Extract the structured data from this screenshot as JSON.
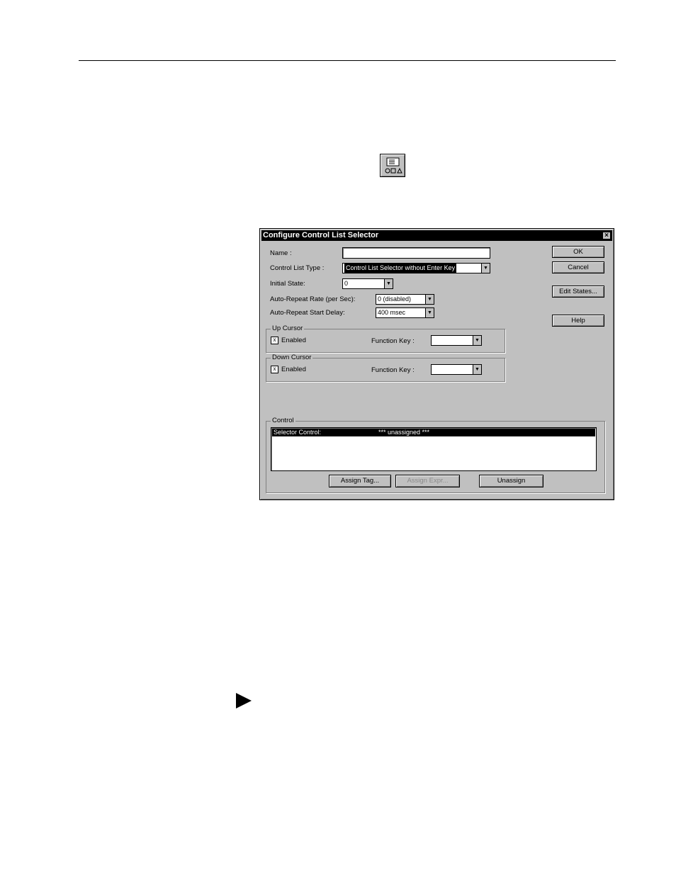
{
  "dialog": {
    "title": "Configure Control List Selector",
    "close_glyph": "×",
    "name_label": "Name :",
    "name_value": "",
    "type_label": "Control List Type :",
    "type_value": "Control List Selector without Enter Key",
    "initial_state_label": "Initial State:",
    "initial_state_value": "0",
    "rate_label": "Auto-Repeat Rate (per Sec):",
    "rate_value": "0 (disabled)",
    "delay_label": "Auto-Repeat Start Delay:",
    "delay_value": "400 msec",
    "up_cursor": {
      "title": "Up Cursor",
      "enabled_label": "Enabled",
      "checked_glyph": "x",
      "fkey_label": "Function Key :",
      "fkey_value": ""
    },
    "down_cursor": {
      "title": "Down Cursor",
      "enabled_label": "Enabled",
      "checked_glyph": "x",
      "fkey_label": "Function Key :",
      "fkey_value": ""
    },
    "control": {
      "title": "Control",
      "row_name": "Selector Control:",
      "row_value": "*** unassigned ***"
    },
    "buttons": {
      "ok": "OK",
      "cancel": "Cancel",
      "edit_states": "Edit States...",
      "help": "Help",
      "assign_tag": "Assign Tag...",
      "assign_expr": "Assign Expr...",
      "unassign": "Unassign"
    },
    "dropdown_glyph": "▼"
  }
}
